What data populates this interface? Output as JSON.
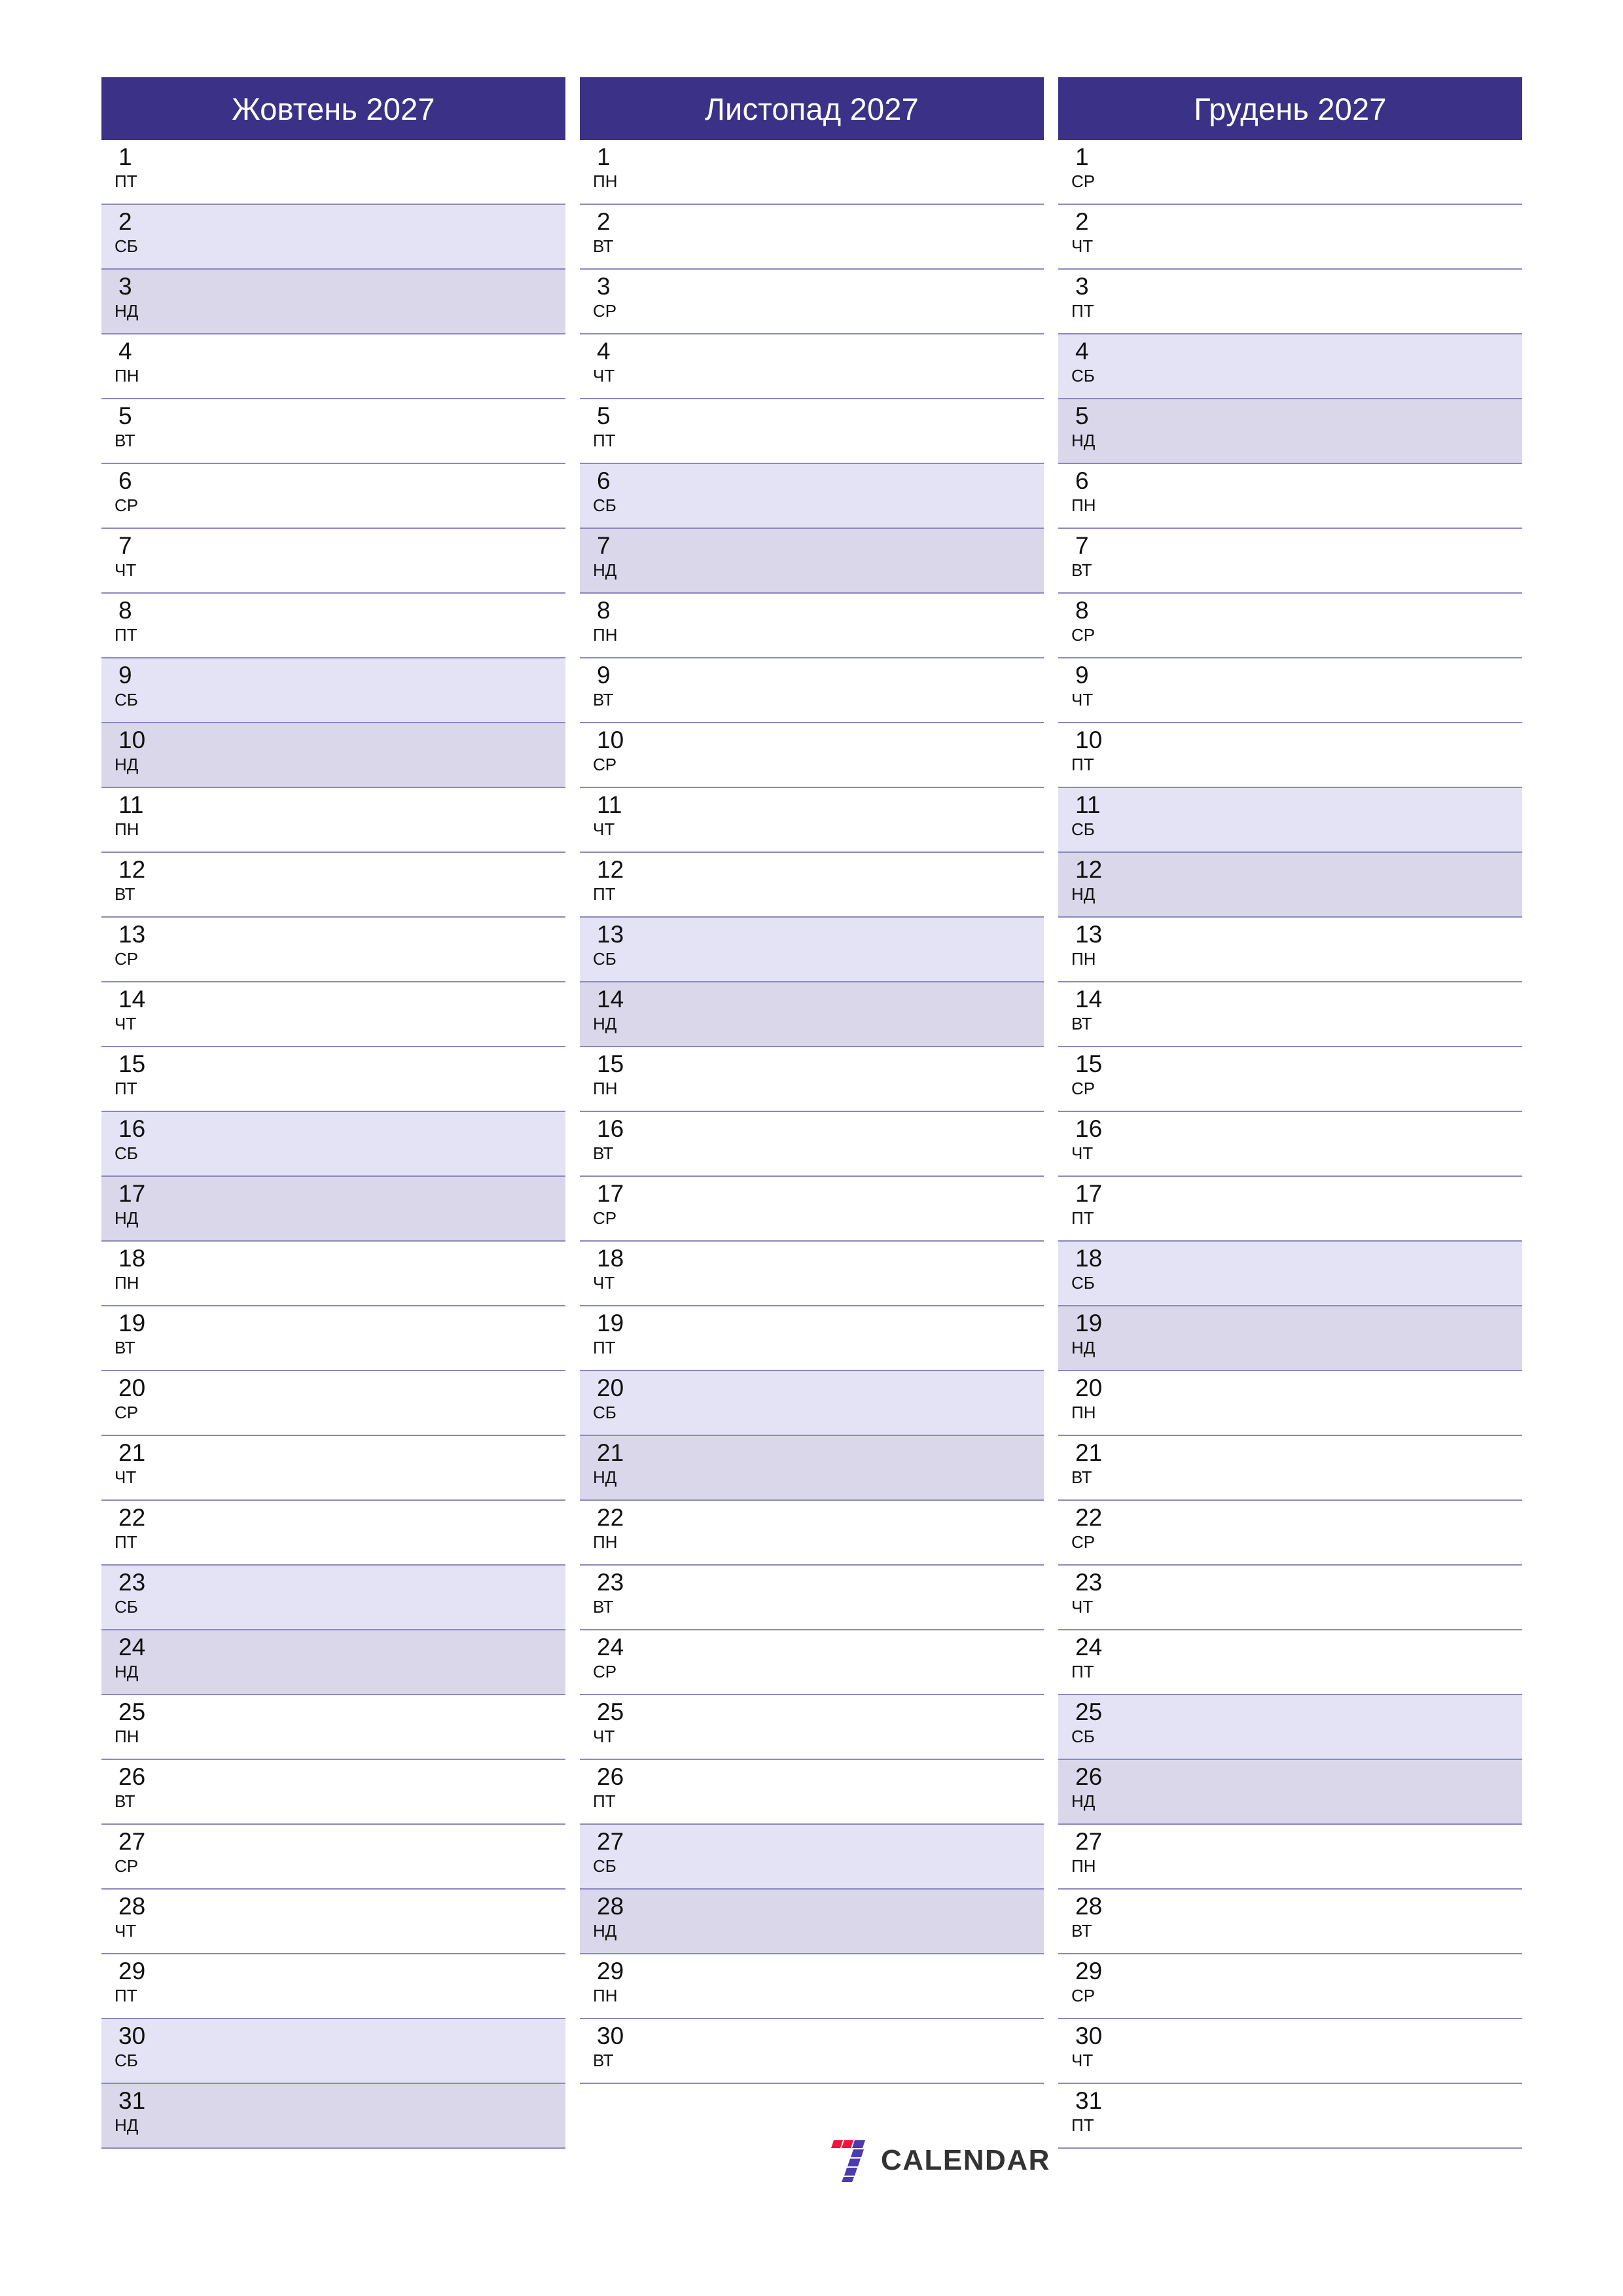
{
  "theme": {
    "header_bg": "#3B3287",
    "header_text": "#FFFFFF",
    "saturday_bg": "#E3E3F5",
    "sunday_bg": "#DAD7EA",
    "row_border": "#8C88BF",
    "day_text": "#111111",
    "logo_red": "#F5123E",
    "logo_purple": "#4A3BAF",
    "logo_text": "#333333"
  },
  "weekday_names": {
    "mon": "ПН",
    "tue": "ВТ",
    "wed": "СР",
    "thu": "ЧТ",
    "fri": "ПТ",
    "sat": "СБ",
    "sun": "НД"
  },
  "logo": {
    "mark": "seven-logo-icon",
    "text": "CALENDAR"
  },
  "months": [
    {
      "title": "Жовтень 2027",
      "days": [
        {
          "num": "1",
          "wd": "ПТ",
          "type": "weekday"
        },
        {
          "num": "2",
          "wd": "СБ",
          "type": "sat"
        },
        {
          "num": "3",
          "wd": "НД",
          "type": "sun"
        },
        {
          "num": "4",
          "wd": "ПН",
          "type": "weekday"
        },
        {
          "num": "5",
          "wd": "ВТ",
          "type": "weekday"
        },
        {
          "num": "6",
          "wd": "СР",
          "type": "weekday"
        },
        {
          "num": "7",
          "wd": "ЧТ",
          "type": "weekday"
        },
        {
          "num": "8",
          "wd": "ПТ",
          "type": "weekday"
        },
        {
          "num": "9",
          "wd": "СБ",
          "type": "sat"
        },
        {
          "num": "10",
          "wd": "НД",
          "type": "sun"
        },
        {
          "num": "11",
          "wd": "ПН",
          "type": "weekday"
        },
        {
          "num": "12",
          "wd": "ВТ",
          "type": "weekday"
        },
        {
          "num": "13",
          "wd": "СР",
          "type": "weekday"
        },
        {
          "num": "14",
          "wd": "ЧТ",
          "type": "weekday"
        },
        {
          "num": "15",
          "wd": "ПТ",
          "type": "weekday"
        },
        {
          "num": "16",
          "wd": "СБ",
          "type": "sat"
        },
        {
          "num": "17",
          "wd": "НД",
          "type": "sun"
        },
        {
          "num": "18",
          "wd": "ПН",
          "type": "weekday"
        },
        {
          "num": "19",
          "wd": "ВТ",
          "type": "weekday"
        },
        {
          "num": "20",
          "wd": "СР",
          "type": "weekday"
        },
        {
          "num": "21",
          "wd": "ЧТ",
          "type": "weekday"
        },
        {
          "num": "22",
          "wd": "ПТ",
          "type": "weekday"
        },
        {
          "num": "23",
          "wd": "СБ",
          "type": "sat"
        },
        {
          "num": "24",
          "wd": "НД",
          "type": "sun"
        },
        {
          "num": "25",
          "wd": "ПН",
          "type": "weekday"
        },
        {
          "num": "26",
          "wd": "ВТ",
          "type": "weekday"
        },
        {
          "num": "27",
          "wd": "СР",
          "type": "weekday"
        },
        {
          "num": "28",
          "wd": "ЧТ",
          "type": "weekday"
        },
        {
          "num": "29",
          "wd": "ПТ",
          "type": "weekday"
        },
        {
          "num": "30",
          "wd": "СБ",
          "type": "sat"
        },
        {
          "num": "31",
          "wd": "НД",
          "type": "sun"
        }
      ]
    },
    {
      "title": "Листопад 2027",
      "days": [
        {
          "num": "1",
          "wd": "ПН",
          "type": "weekday"
        },
        {
          "num": "2",
          "wd": "ВТ",
          "type": "weekday"
        },
        {
          "num": "3",
          "wd": "СР",
          "type": "weekday"
        },
        {
          "num": "4",
          "wd": "ЧТ",
          "type": "weekday"
        },
        {
          "num": "5",
          "wd": "ПТ",
          "type": "weekday"
        },
        {
          "num": "6",
          "wd": "СБ",
          "type": "sat"
        },
        {
          "num": "7",
          "wd": "НД",
          "type": "sun"
        },
        {
          "num": "8",
          "wd": "ПН",
          "type": "weekday"
        },
        {
          "num": "9",
          "wd": "ВТ",
          "type": "weekday"
        },
        {
          "num": "10",
          "wd": "СР",
          "type": "weekday"
        },
        {
          "num": "11",
          "wd": "ЧТ",
          "type": "weekday"
        },
        {
          "num": "12",
          "wd": "ПТ",
          "type": "weekday"
        },
        {
          "num": "13",
          "wd": "СБ",
          "type": "sat"
        },
        {
          "num": "14",
          "wd": "НД",
          "type": "sun"
        },
        {
          "num": "15",
          "wd": "ПН",
          "type": "weekday"
        },
        {
          "num": "16",
          "wd": "ВТ",
          "type": "weekday"
        },
        {
          "num": "17",
          "wd": "СР",
          "type": "weekday"
        },
        {
          "num": "18",
          "wd": "ЧТ",
          "type": "weekday"
        },
        {
          "num": "19",
          "wd": "ПТ",
          "type": "weekday"
        },
        {
          "num": "20",
          "wd": "СБ",
          "type": "sat"
        },
        {
          "num": "21",
          "wd": "НД",
          "type": "sun"
        },
        {
          "num": "22",
          "wd": "ПН",
          "type": "weekday"
        },
        {
          "num": "23",
          "wd": "ВТ",
          "type": "weekday"
        },
        {
          "num": "24",
          "wd": "СР",
          "type": "weekday"
        },
        {
          "num": "25",
          "wd": "ЧТ",
          "type": "weekday"
        },
        {
          "num": "26",
          "wd": "ПТ",
          "type": "weekday"
        },
        {
          "num": "27",
          "wd": "СБ",
          "type": "sat"
        },
        {
          "num": "28",
          "wd": "НД",
          "type": "sun"
        },
        {
          "num": "29",
          "wd": "ПН",
          "type": "weekday"
        },
        {
          "num": "30",
          "wd": "ВТ",
          "type": "weekday"
        }
      ]
    },
    {
      "title": "Грудень 2027",
      "days": [
        {
          "num": "1",
          "wd": "СР",
          "type": "weekday"
        },
        {
          "num": "2",
          "wd": "ЧТ",
          "type": "weekday"
        },
        {
          "num": "3",
          "wd": "ПТ",
          "type": "weekday"
        },
        {
          "num": "4",
          "wd": "СБ",
          "type": "sat"
        },
        {
          "num": "5",
          "wd": "НД",
          "type": "sun"
        },
        {
          "num": "6",
          "wd": "ПН",
          "type": "weekday"
        },
        {
          "num": "7",
          "wd": "ВТ",
          "type": "weekday"
        },
        {
          "num": "8",
          "wd": "СР",
          "type": "weekday"
        },
        {
          "num": "9",
          "wd": "ЧТ",
          "type": "weekday"
        },
        {
          "num": "10",
          "wd": "ПТ",
          "type": "weekday"
        },
        {
          "num": "11",
          "wd": "СБ",
          "type": "sat"
        },
        {
          "num": "12",
          "wd": "НД",
          "type": "sun"
        },
        {
          "num": "13",
          "wd": "ПН",
          "type": "weekday"
        },
        {
          "num": "14",
          "wd": "ВТ",
          "type": "weekday"
        },
        {
          "num": "15",
          "wd": "СР",
          "type": "weekday"
        },
        {
          "num": "16",
          "wd": "ЧТ",
          "type": "weekday"
        },
        {
          "num": "17",
          "wd": "ПТ",
          "type": "weekday"
        },
        {
          "num": "18",
          "wd": "СБ",
          "type": "sat"
        },
        {
          "num": "19",
          "wd": "НД",
          "type": "sun"
        },
        {
          "num": "20",
          "wd": "ПН",
          "type": "weekday"
        },
        {
          "num": "21",
          "wd": "ВТ",
          "type": "weekday"
        },
        {
          "num": "22",
          "wd": "СР",
          "type": "weekday"
        },
        {
          "num": "23",
          "wd": "ЧТ",
          "type": "weekday"
        },
        {
          "num": "24",
          "wd": "ПТ",
          "type": "weekday"
        },
        {
          "num": "25",
          "wd": "СБ",
          "type": "sat"
        },
        {
          "num": "26",
          "wd": "НД",
          "type": "sun"
        },
        {
          "num": "27",
          "wd": "ПН",
          "type": "weekday"
        },
        {
          "num": "28",
          "wd": "ВТ",
          "type": "weekday"
        },
        {
          "num": "29",
          "wd": "СР",
          "type": "weekday"
        },
        {
          "num": "30",
          "wd": "ЧТ",
          "type": "weekday"
        },
        {
          "num": "31",
          "wd": "ПТ",
          "type": "weekday"
        }
      ]
    }
  ]
}
